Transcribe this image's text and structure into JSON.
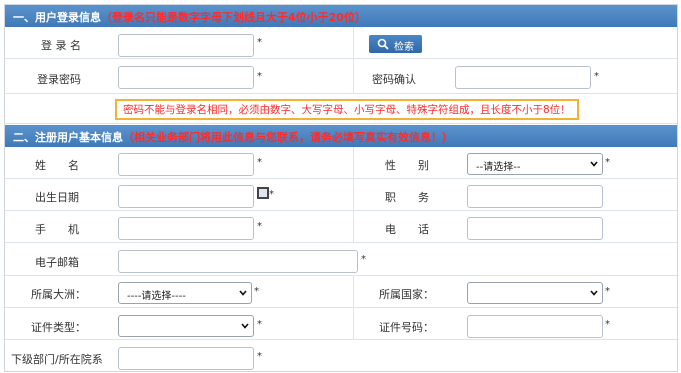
{
  "section1": {
    "title": "一、用户登录信息",
    "note": "（登录名只能是数字字母下划线且大于4位小于20位）",
    "login_name_label": "登 录 名",
    "search_button": "检索",
    "password_label": "登录密码",
    "confirm_label": "密码确认",
    "password_warning": "密码不能与登录名相同，必须由数字、大写字母、小写字母、特殊字符组成，且长度不小于8位！"
  },
  "section2": {
    "title": "二、注册用户基本信息",
    "note": "（相关业务部门将用此信息与您联系，请务必填写真实有效信息！）",
    "name_label": "姓　　名",
    "gender_label": "性　　别",
    "gender_value": "--请选择--",
    "birth_label": "出生日期",
    "job_label": "职　　务",
    "mobile_label": "手　　机",
    "phone_label": "电　　话",
    "email_label": "电子邮箱",
    "continent_label": "所属大洲：",
    "continent_value": "----请选择----",
    "country_label": "所属国家：",
    "country_value": "",
    "idtype_label": "证件类型：",
    "idtype_value": "",
    "idno_label": "证件号码：",
    "dept_label": "下级部门/所在院系"
  },
  "required_mark": "*",
  "colors": {
    "header": "#4a85c3",
    "note": "#ff2a2a",
    "warning_border": "#f2b233"
  }
}
